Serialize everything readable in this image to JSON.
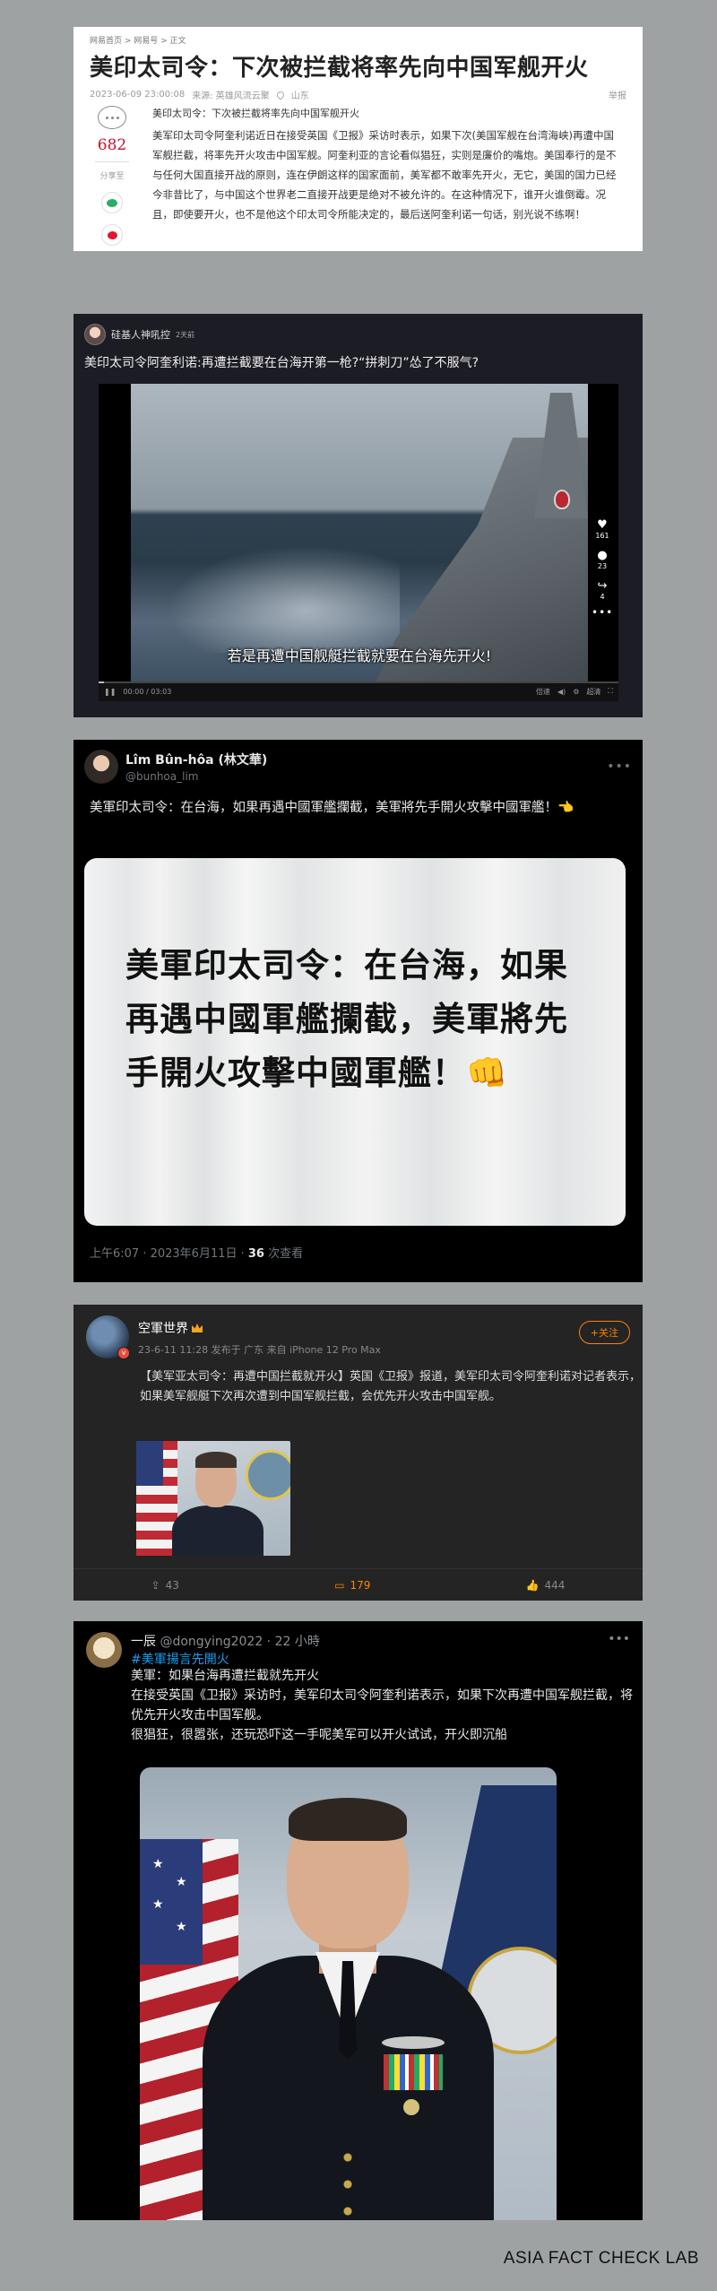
{
  "netease": {
    "breadcrumb": "网易首页 > 网易号 > 正文",
    "headline": "美印太司令：下次被拦截将率先向中国军舰开火",
    "date": "2023-06-09 23:00:08",
    "source": "来源: 英雄风流云聚",
    "location": "山东",
    "report": "举报",
    "comment_count": "682",
    "share_label": "分享至",
    "summary": "美印太司令：下次被拦截将率先向中国军舰开火",
    "body": "美军印太司令阿奎利诺近日在接受英国《卫报》采访时表示，如果下次(美国军舰在台湾海峡)再遭中国军舰拦截，将率先开火攻击中国军舰。阿奎利亚的言论看似猖狂，实则是廉价的嘴炮。美国奉行的是不与任何大国直接开战的原则，连在伊朗这样的国家面前，美军都不敢率先开火，无它，美国的国力已经今非昔比了，与中国这个世界老二直接开战更是绝对不被允许的。在这种情况下，谁开火谁倒霉。况且，即使要开火，也不是他这个印太司令所能决定的，最后送阿奎利诺一句话，别光说不练啊！"
  },
  "video": {
    "username": "硅基人神吼控",
    "time_ago": "2天前",
    "title": "美印太司令阿奎利诺:再遭拦截要在台海开第一枪?“拼刺刀”怂了不服气?",
    "subtitle": "若是再遭中国舰艇拦截就要在台海先开火!",
    "likes": "161",
    "comments": "23",
    "shares": "4",
    "time": "00:00 / 03:03",
    "ctrl_right": "超清",
    "ctrl_speed": "倍速",
    "progress": 0.01
  },
  "tweet": {
    "name": "Lîm Bûn-hôa (林文華)",
    "handle": "@bunhoa_lim",
    "text": "美軍印太司令：在台海，如果再遇中國軍艦攔截，美軍將先手開火攻擊中國軍艦！👈",
    "card_text": "美軍印太司令：在台海，如果再遇中國軍艦攔截，美軍將先手開火攻擊中國軍艦！👊",
    "timestamp": "上午6:07 · 2023年6月11日 · ",
    "views": "36",
    "views_label": " 次查看"
  },
  "weibo": {
    "name": "空軍世界",
    "meta": "23-6-11 11:28  发布于 广东  来自 iPhone 12 Pro Max",
    "follow": "+关注",
    "body": "【美军亚太司令：再遭中国拦截就开火】英国《卫报》报道，美军印太司令阿奎利诺对记者表示，如果美军舰艇下次再次遭到中国军舰拦截，会优先开火攻击中国军舰。",
    "reposts": "43",
    "comments": "179",
    "likes": "444"
  },
  "threads": {
    "name": "一辰",
    "handle": "@dongying2022 · 22 小時",
    "hashtag": "#美軍揚言先開火",
    "line1": "美軍：如果台海再遭拦截就先开火",
    "line2": "在接受英国《卫报》采访时，美军印太司令阿奎利诺表示，如果下次再遭中国军舰拦截，将优先开火攻击中国军舰。",
    "line3": "很猖狂，很嚣张，还玩恐吓这一手呢美军可以开火试试，开火即沉船"
  },
  "credit": "ASIA FACT CHECK LAB"
}
